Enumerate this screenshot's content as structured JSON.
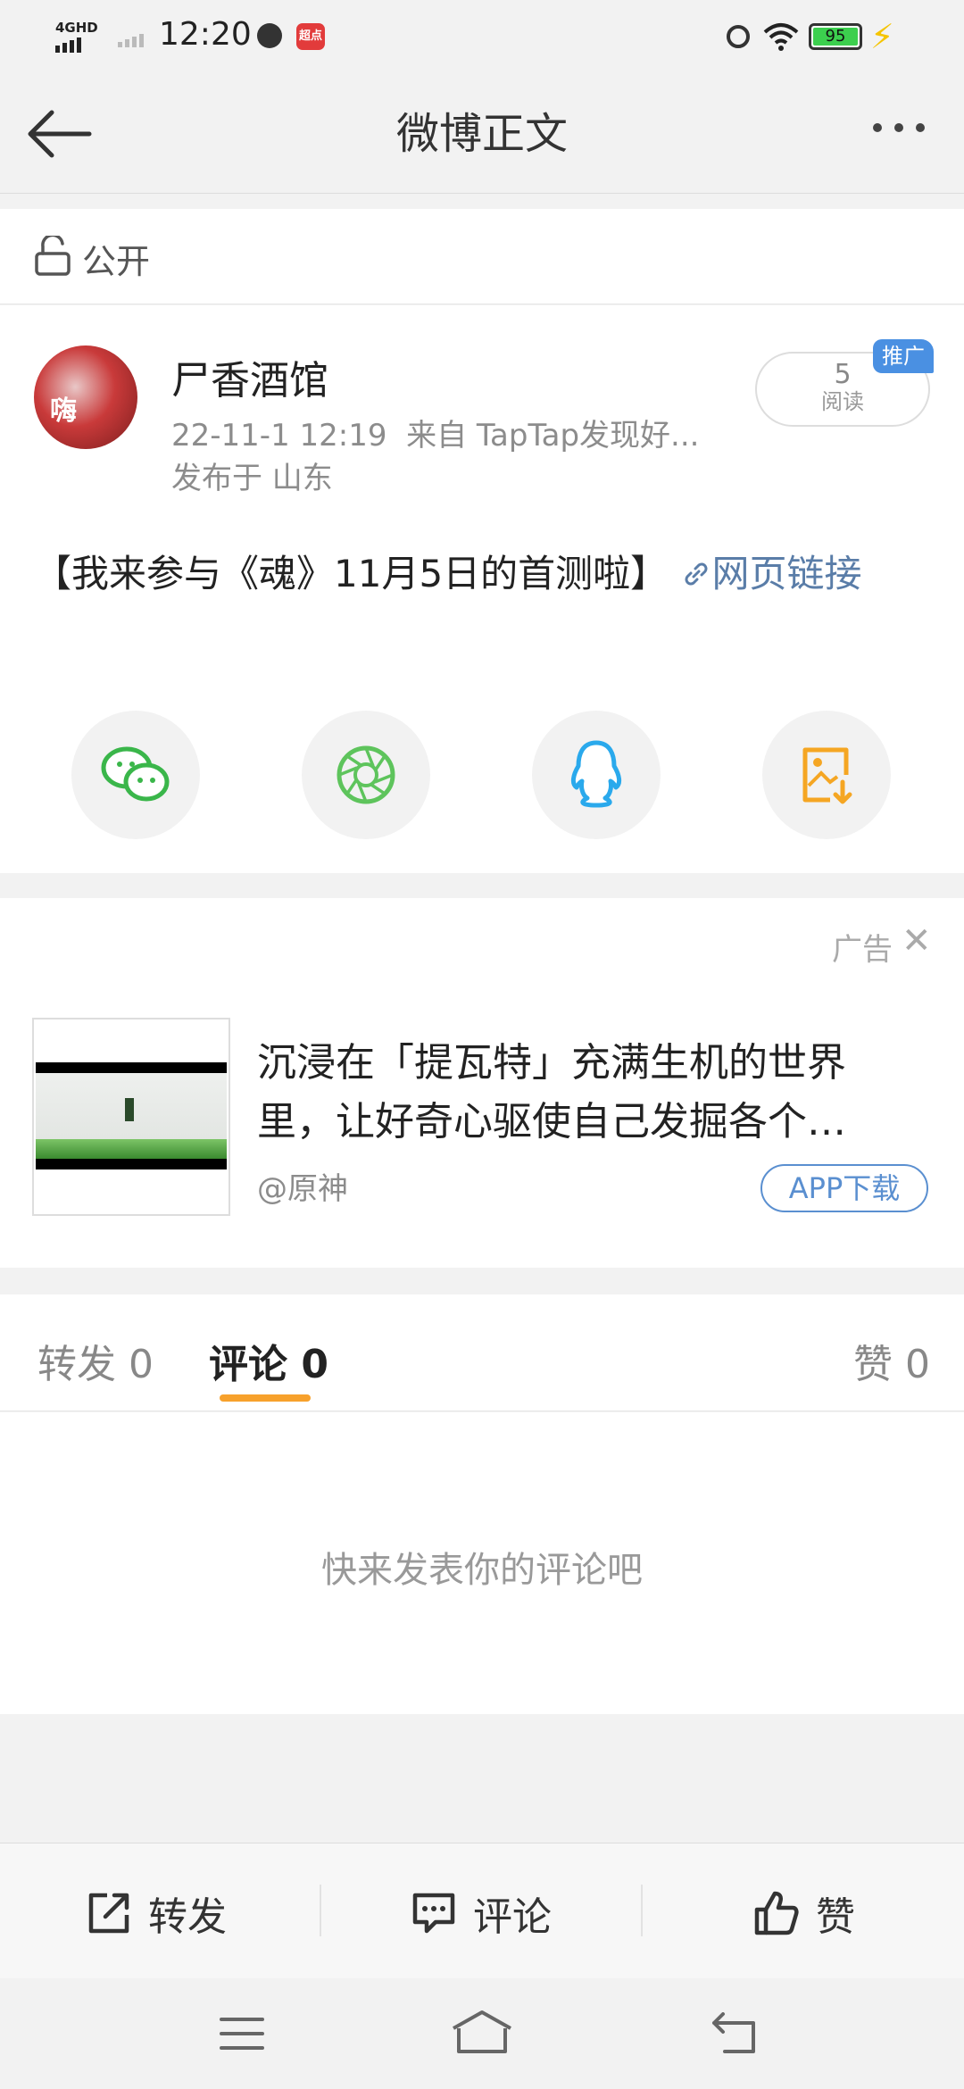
{
  "status_bar": {
    "network": "4GHD",
    "time": "12:20",
    "app_badge": "超点",
    "battery": "95"
  },
  "header": {
    "title": "微博正文"
  },
  "visibility": {
    "label": "公开"
  },
  "post": {
    "author": "尸香酒馆",
    "time_source": "22-11-1 12:19  来自 TapTap发现好...",
    "location": "发布于 山东",
    "read_count": "5",
    "read_label": "阅读",
    "promo_badge": "推广",
    "text_main": "【我来参与《魂》11月5日的首测啦】",
    "link_text": "网页链接"
  },
  "share_icons": [
    "wechat-icon",
    "moments-icon",
    "qq-icon",
    "save-image-icon"
  ],
  "ad": {
    "label": "广告",
    "title": "沉浸在「提瓦特」充满生机的世界里，让好奇心驱使自己发掘各个…",
    "source": "@原神",
    "button": "APP下载"
  },
  "tabs": {
    "repost": "转发",
    "repost_count": "0",
    "comment": "评论",
    "comment_count": "0",
    "like": "赞",
    "like_count": "0"
  },
  "empty_comments": "快来发表你的评论吧",
  "bottom_bar": {
    "repost": "转发",
    "comment": "评论",
    "like": "赞"
  },
  "colors": {
    "accent_orange": "#f7a12c",
    "link_blue": "#5a7da8",
    "promo_blue": "#4a90e2"
  }
}
